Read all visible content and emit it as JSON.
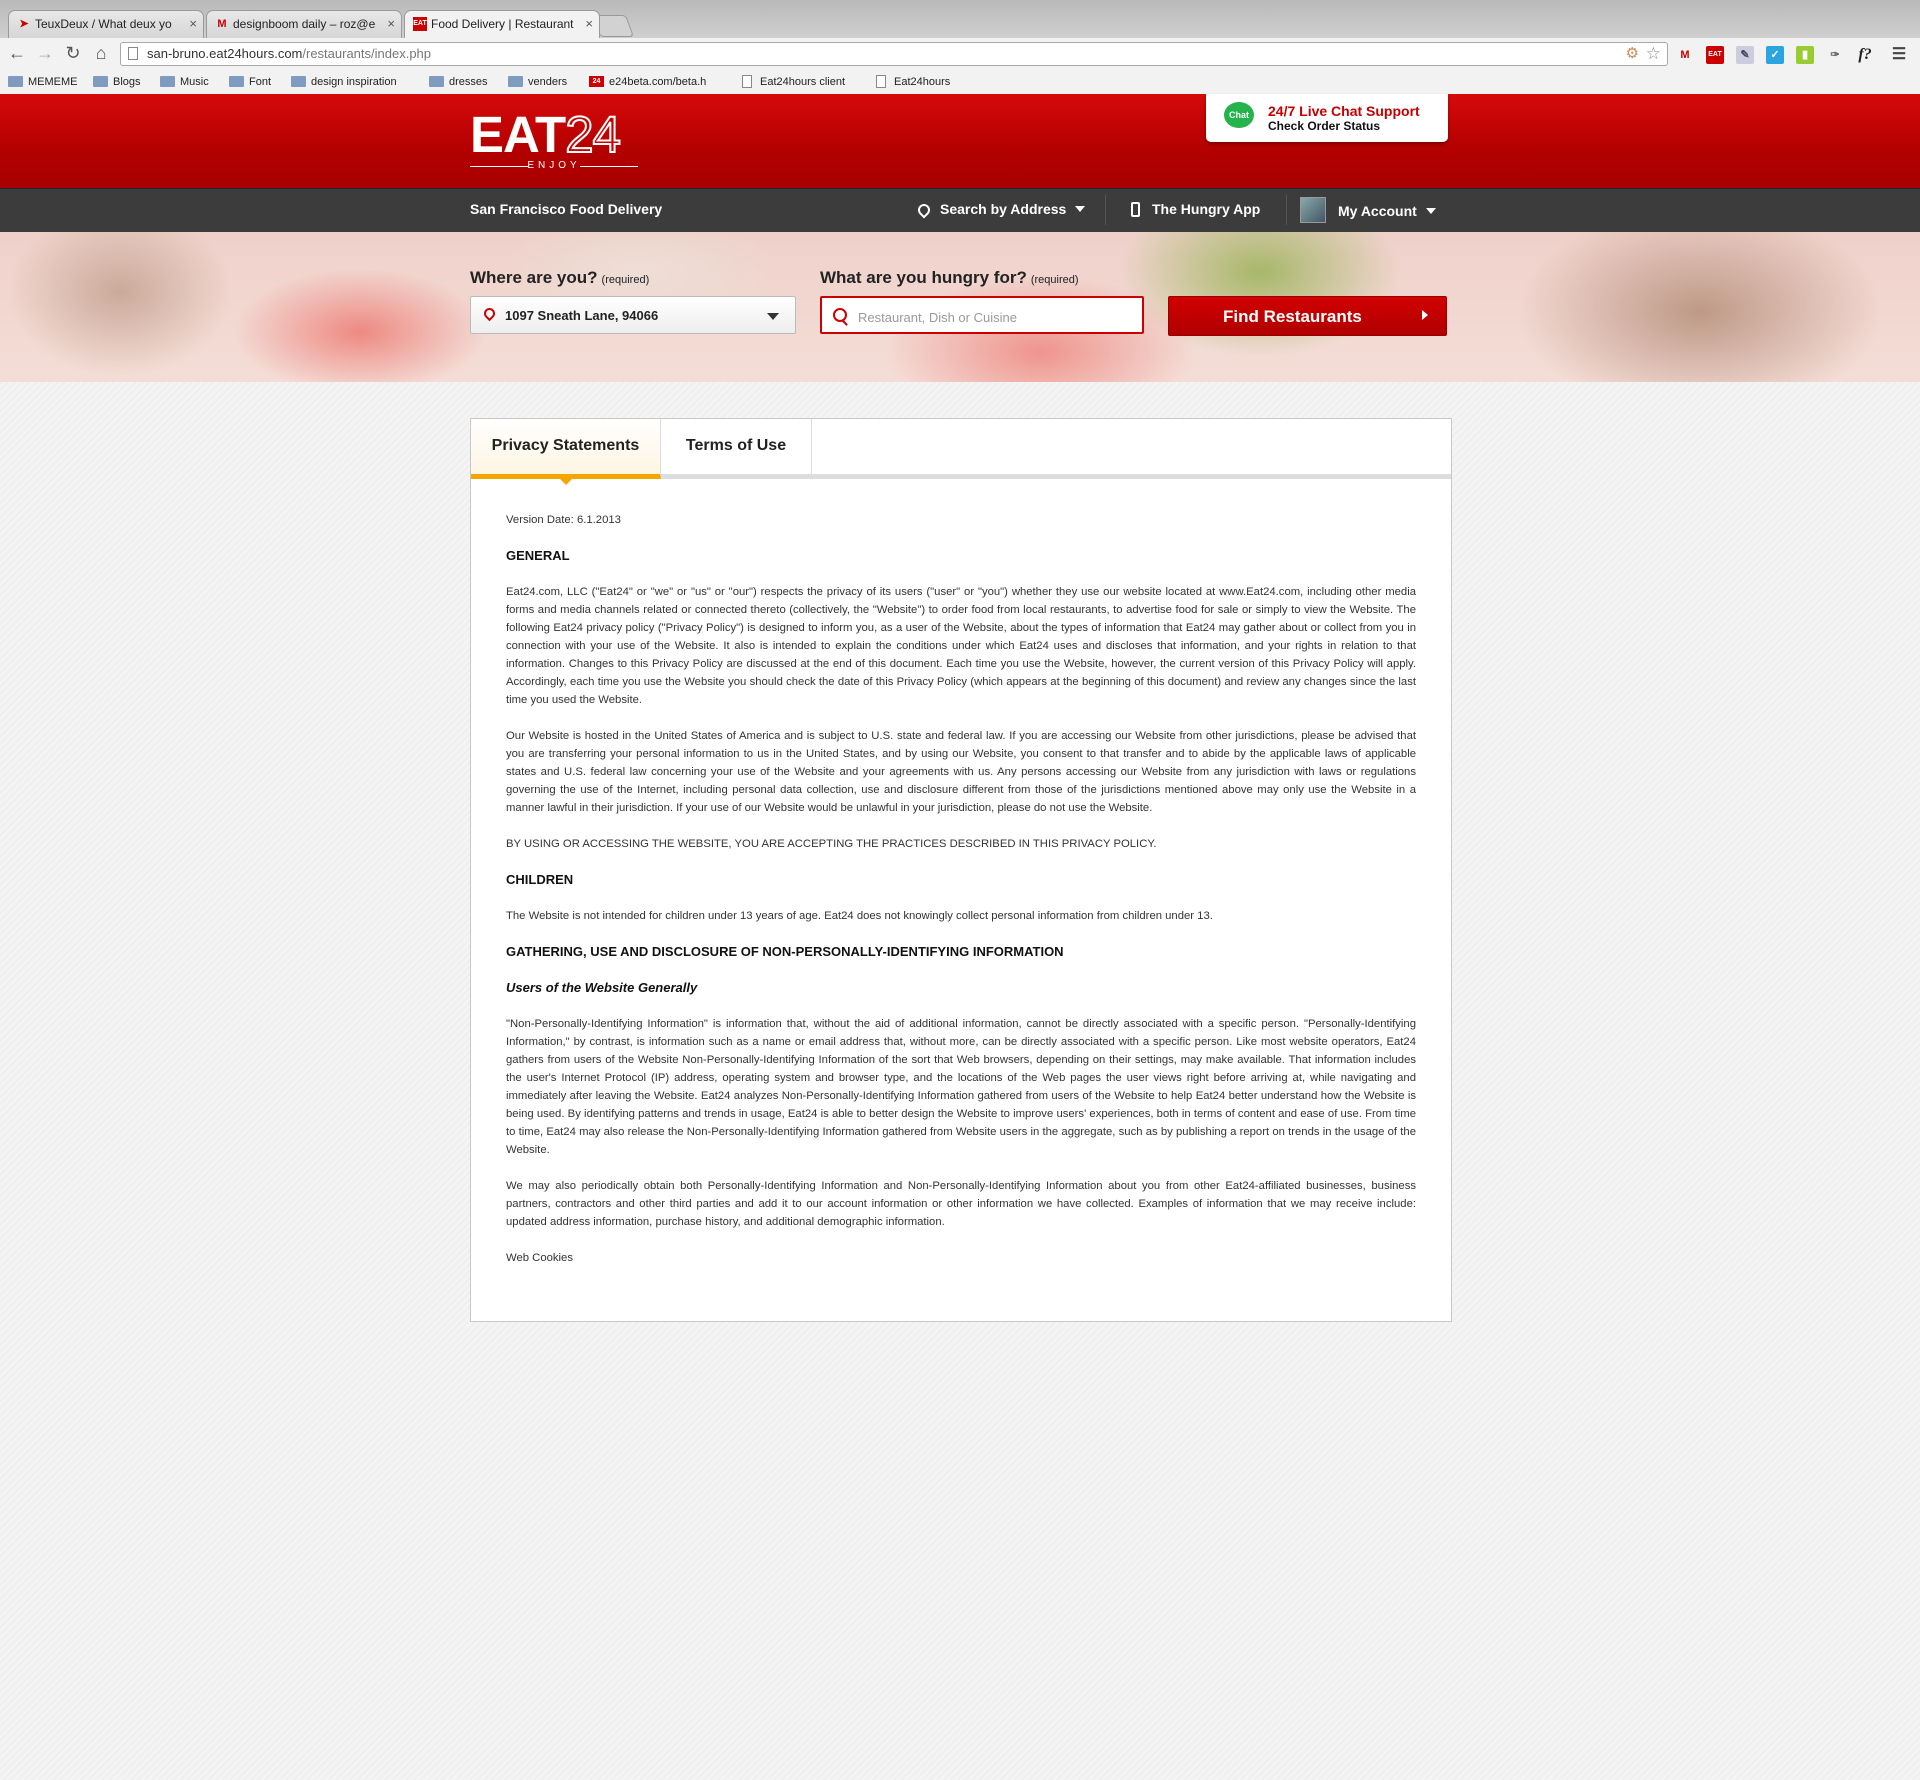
{
  "browser": {
    "tabs": [
      {
        "title": "TeuxDeux / What deux yo",
        "favicon": "teuxdeux-icon"
      },
      {
        "title": "designboom daily – roz@e",
        "favicon": "gmail-icon"
      },
      {
        "title": "Food Delivery | Restaurant",
        "favicon": "eat24-icon"
      }
    ],
    "url_host": "san-bruno.eat24hours.com",
    "url_path": "/restaurants/index.php",
    "bookmarks": [
      {
        "label": "MEMEME",
        "type": "folder"
      },
      {
        "label": "Blogs",
        "type": "folder"
      },
      {
        "label": "Music",
        "type": "folder"
      },
      {
        "label": "Font",
        "type": "folder"
      },
      {
        "label": "design inspiration",
        "type": "folder"
      },
      {
        "label": "dresses",
        "type": "folder"
      },
      {
        "label": "venders",
        "type": "folder"
      },
      {
        "label": "e24beta.com/beta.h",
        "type": "site"
      },
      {
        "label": "Eat24hours client",
        "type": "page"
      },
      {
        "label": "Eat24hours",
        "type": "page"
      }
    ]
  },
  "header": {
    "logo_text": "EAT",
    "logo_num": "24",
    "logo_tagline": "ENJOY",
    "chat_badge": "Chat",
    "chat_line1": "24/7 Live Chat Support",
    "chat_line2": "Check Order Status"
  },
  "nav": {
    "city": "San Francisco Food Delivery",
    "search_by_address": "Search by Address",
    "hungry_app": "The Hungry App",
    "my_account": "My Account"
  },
  "search": {
    "where_label": "Where are you?",
    "where_required": "(required)",
    "location_value": "1097 Sneath Lane, 94066",
    "what_label": "What are you hungry for?",
    "what_required": "(required)",
    "food_placeholder": "Restaurant, Dish or Cuisine",
    "find_button": "Find Restaurants"
  },
  "tabs": {
    "privacy": "Privacy Statements",
    "terms": "Terms of Use"
  },
  "document": {
    "version": "Version Date: 6.1.2013",
    "general_heading": "GENERAL",
    "general_p1": "Eat24.com, LLC (\"Eat24\" or \"we\" or \"us\" or \"our\") respects the privacy of its users (\"user\" or \"you\") whether they use our website located at www.Eat24.com, including other media forms and media channels related or connected thereto (collectively, the \"Website\") to order food from local restaurants, to advertise food for sale or simply to view the Website. The following Eat24 privacy policy (\"Privacy Policy\") is designed to inform you, as a user of the Website, about the types of information that Eat24 may gather about or collect from you in connection with your use of the Website. It also is intended to explain the conditions under which Eat24 uses and discloses that information, and your rights in relation to that information. Changes to this Privacy Policy are discussed at the end of this document. Each time you use the Website, however, the current version of this Privacy Policy will apply. Accordingly, each time you use the Website you should check the date of this Privacy Policy (which appears at the beginning of this document) and review any changes since the last time you used the Website.",
    "general_p2": "Our Website is hosted in the United States of America and is subject to U.S. state and federal law. If you are accessing our Website from other jurisdictions, please be advised that you are transferring your personal information to us in the United States, and by using our Website, you consent to that transfer and to abide by the applicable laws of applicable states and U.S. federal law concerning your use of the Website and your agreements with us. Any persons accessing our Website from any jurisdiction with laws or regulations governing the use of the Internet, including personal data collection, use and disclosure different from those of the jurisdictions mentioned above may only use the Website in a manner lawful in their jurisdiction. If your use of our Website would be unlawful in your jurisdiction, please do not use the Website.",
    "general_p3": "BY USING OR ACCESSING THE WEBSITE, YOU ARE ACCEPTING THE PRACTICES DESCRIBED IN THIS PRIVACY POLICY.",
    "children_heading": "CHILDREN",
    "children_p1": "The Website is not intended for children under 13 years of age. Eat24 does not knowingly collect personal information from children under 13.",
    "gathering_heading": "GATHERING, USE AND DISCLOSURE OF NON-PERSONALLY-IDENTIFYING INFORMATION",
    "users_subheading": "Users of the Website Generally",
    "users_p1": "\"Non-Personally-Identifying Information\" is information that, without the aid of additional information, cannot be directly associated with a specific person. \"Personally-Identifying Information,\" by contrast, is information such as a name or email address that, without more, can be directly associated with a specific person. Like most website operators, Eat24 gathers from users of the Website Non-Personally-Identifying Information of the sort that Web browsers, depending on their settings, may make available. That information includes the user's Internet Protocol (IP) address, operating system and browser type, and the locations of the Web pages the user views right before arriving at, while navigating and immediately after leaving the Website. Eat24 analyzes Non-Personally-Identifying Information gathered from users of the Website to help Eat24 better understand how the Website is being used. By identifying patterns and trends in usage, Eat24 is able to better design the Website to improve users' experiences, both in terms of content and ease of use. From time to time, Eat24 may also release the Non-Personally-Identifying Information gathered from Website users in the aggregate, such as by publishing a report on trends in the usage of the Website.",
    "users_p2": "We may also periodically obtain both Personally-Identifying Information and Non-Personally-Identifying Information about you from other Eat24-affiliated businesses, business partners, contractors and other third parties and add it to our account information or other information we have collected. Examples of information that we may receive include: updated address information, purchase history, and additional demographic information.",
    "web_cookies": "Web Cookies"
  }
}
